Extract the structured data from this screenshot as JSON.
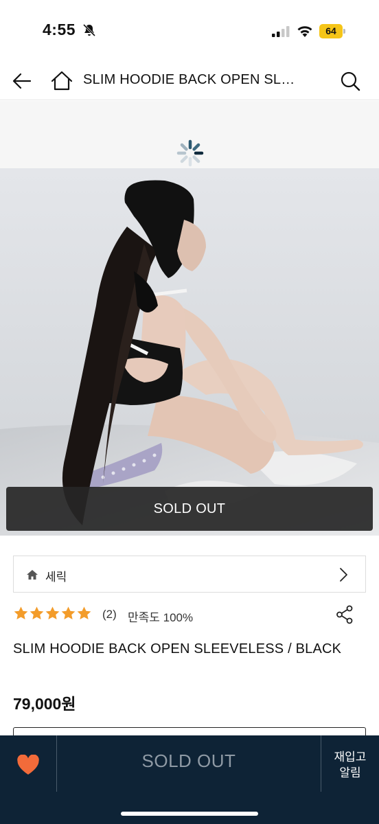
{
  "status_bar": {
    "time": "4:55",
    "battery": "64",
    "icons": [
      "bell-off-icon",
      "signal-icon",
      "wifi-icon",
      "battery-icon"
    ]
  },
  "nav": {
    "title": "SLIM HOODIE BACK OPEN SLEEVELESS / BLACK",
    "icons": [
      "back-arrow-icon",
      "home-icon",
      "search-icon"
    ]
  },
  "product": {
    "sold_out_overlay": "SOLD OUT",
    "brand": "세릭",
    "rating": 5,
    "review_count": "(2)",
    "satisfaction": "만족도 100%",
    "name": "SLIM HOODIE BACK OPEN SLEEVELESS / BLACK",
    "price": "79,000원"
  },
  "bottom_bar": {
    "soldout_label": "SOLD OUT",
    "restock_label_line1": "재입고",
    "restock_label_line2": "알림"
  },
  "colors": {
    "bottom_bar": "#0e2336",
    "star": "#f39c2a",
    "heart": "#f26b3a",
    "battery": "#f5c518"
  }
}
